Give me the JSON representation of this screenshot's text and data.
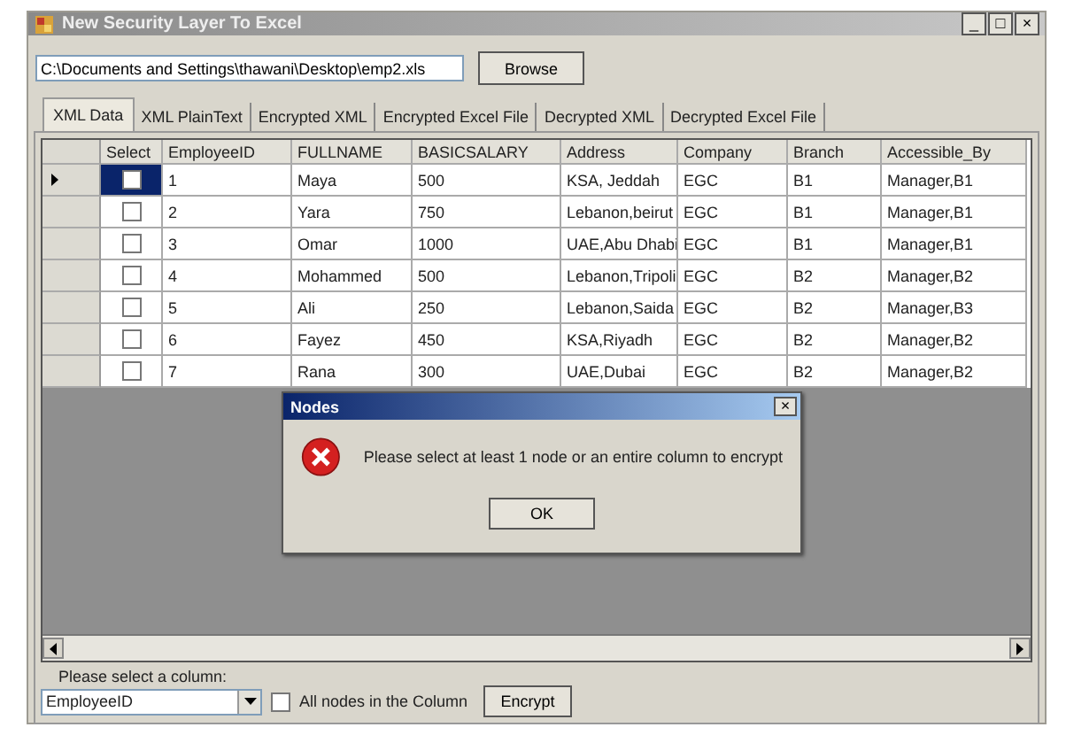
{
  "window": {
    "title": "New Security Layer To Excel",
    "controls": [
      "_",
      "□",
      "×"
    ]
  },
  "file_path": {
    "value": "C:\\Documents and Settings\\thawani\\Desktop\\emp2.xls"
  },
  "browse_button": "Browse",
  "tabs": [
    {
      "label": "XML Data",
      "selected": true
    },
    {
      "label": "XML PlainText",
      "selected": false
    },
    {
      "label": "Encrypted XML",
      "selected": false
    },
    {
      "label": "Encrypted Excel File",
      "selected": false
    },
    {
      "label": "Decrypted XML",
      "selected": false
    },
    {
      "label": "Decrypted Excel File",
      "selected": false
    }
  ],
  "table": {
    "select_column": "Select",
    "columns": [
      "EmployeeID",
      "FULLNAME",
      "BASICSALARY",
      "Address",
      "Company",
      "Branch",
      "Accessible_By"
    ],
    "rows": [
      {
        "selected": true,
        "checked": false,
        "cells": [
          "1",
          "Maya",
          "500",
          "KSA, Jeddah",
          "EGC",
          "B1",
          "Manager,B1"
        ]
      },
      {
        "selected": false,
        "checked": false,
        "cells": [
          "2",
          "Yara",
          "750",
          "Lebanon,beirut",
          "EGC",
          "B1",
          "Manager,B1"
        ]
      },
      {
        "selected": false,
        "checked": false,
        "cells": [
          "3",
          "Omar",
          "1000",
          "UAE,Abu Dhabi",
          "EGC",
          "B1",
          "Manager,B1"
        ]
      },
      {
        "selected": false,
        "checked": false,
        "cells": [
          "4",
          "Mohammed",
          "500",
          "Lebanon,Tripoli",
          "EGC",
          "B2",
          "Manager,B2"
        ]
      },
      {
        "selected": false,
        "checked": false,
        "cells": [
          "5",
          "Ali",
          "250",
          "Lebanon,Saida",
          "EGC",
          "B2",
          "Manager,B3"
        ]
      },
      {
        "selected": false,
        "checked": false,
        "cells": [
          "6",
          "Fayez",
          "450",
          "KSA,Riyadh",
          "EGC",
          "B2",
          "Manager,B2"
        ]
      },
      {
        "selected": false,
        "checked": false,
        "cells": [
          "7",
          "Rana",
          "300",
          "UAE,Dubai",
          "EGC",
          "B2",
          "Manager,B2"
        ]
      }
    ]
  },
  "dialog": {
    "title": "Nodes",
    "close": "×",
    "message": "Please select at least 1 node or an entire column to encrypt",
    "button": "OK"
  },
  "column_label": "Please select a column:",
  "column_select": {
    "value": "EmployeeID"
  },
  "all_nodes": {
    "label": "All nodes in the Column",
    "checked": false
  },
  "encrypt_button": "Encrypt"
}
